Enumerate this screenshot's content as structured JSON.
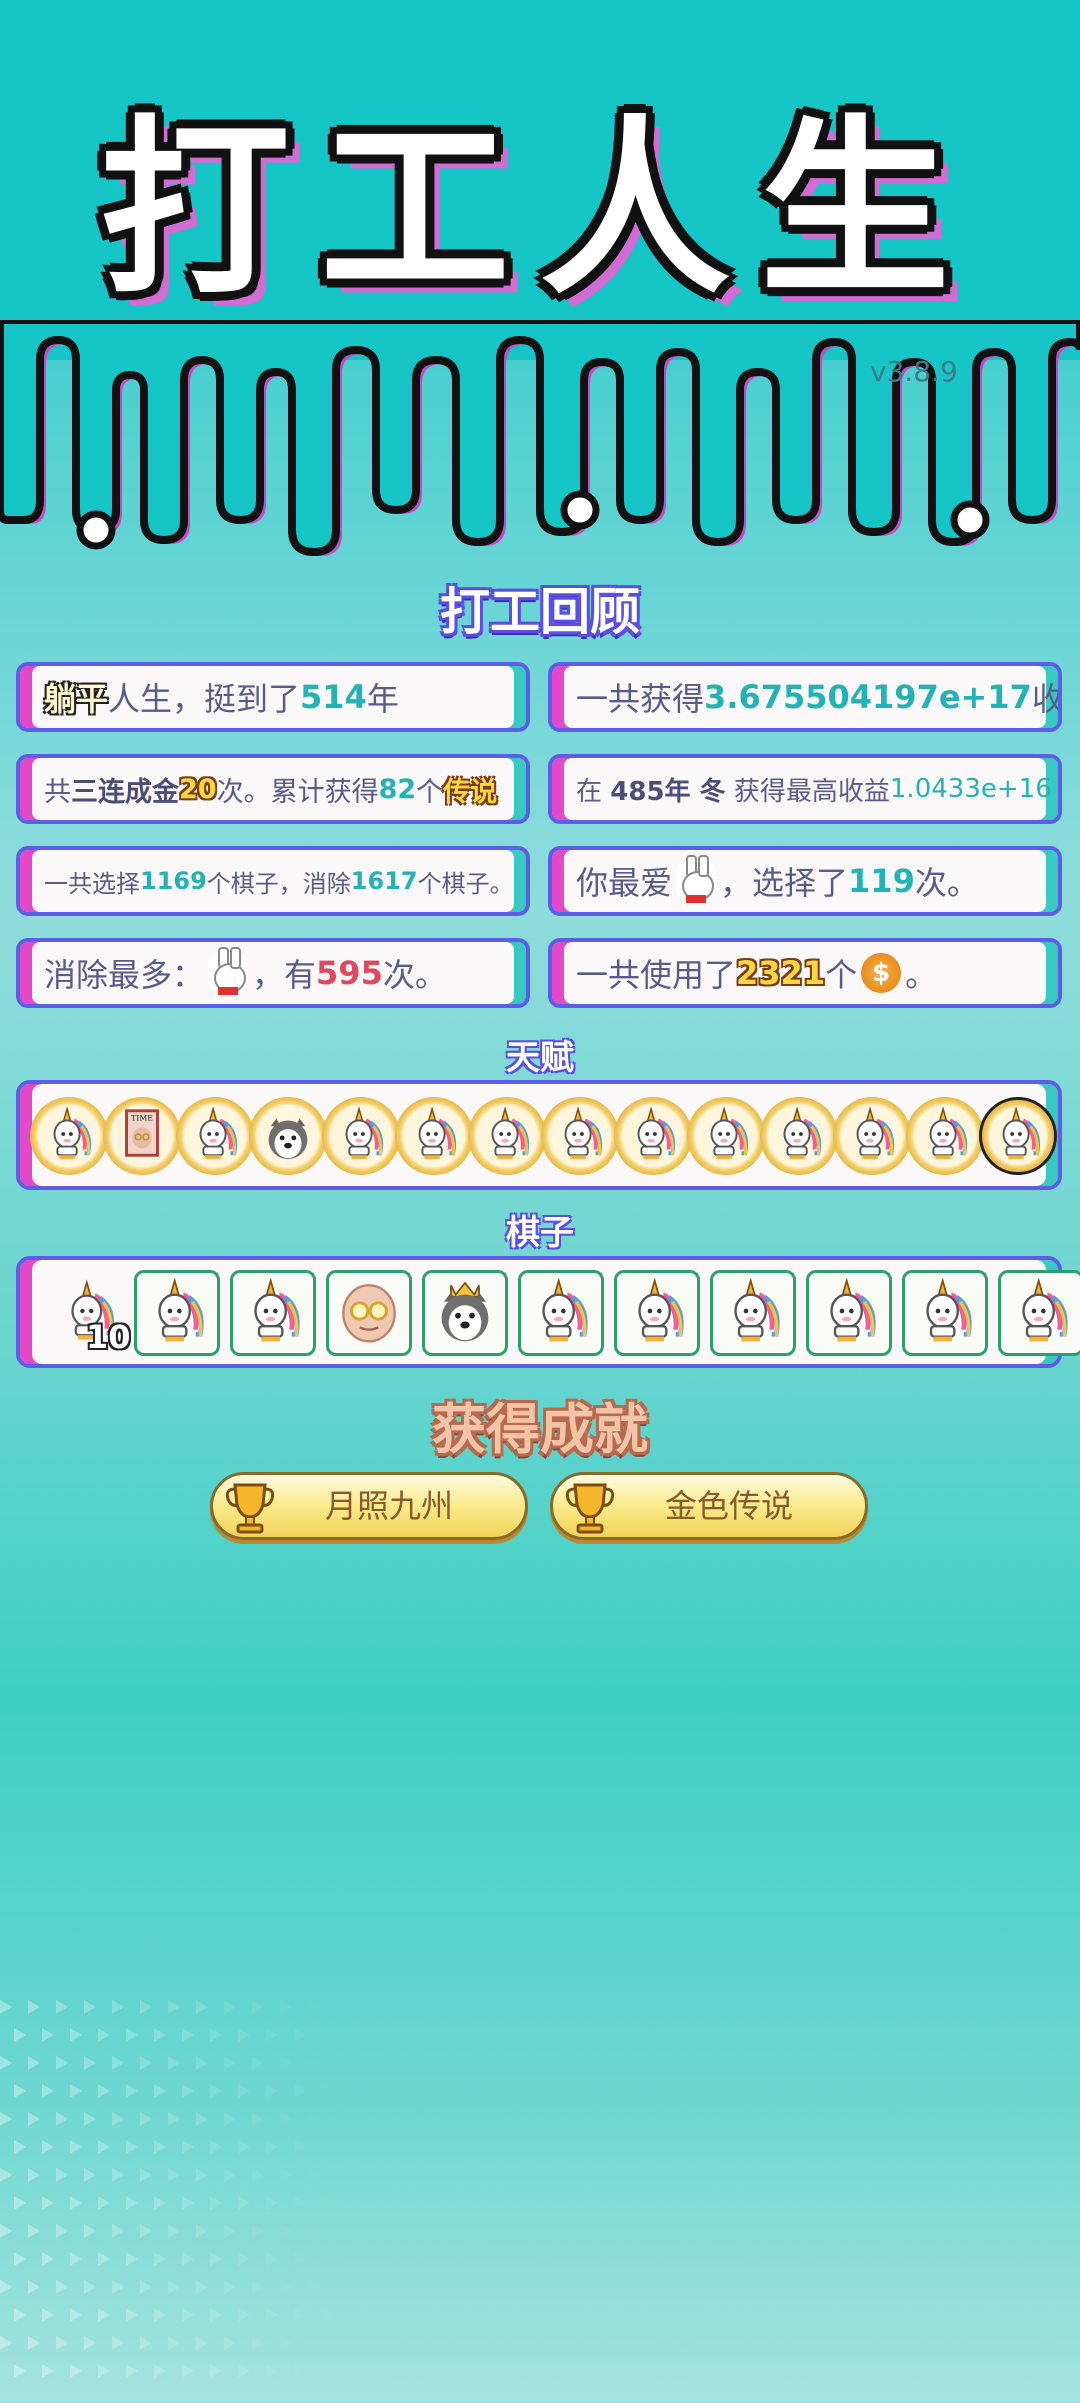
{
  "title": "打工人生",
  "version": "v3.8.9",
  "review": {
    "heading": "打工回顾",
    "card1": {
      "badge": "躺平",
      "pre": "人生，挺到了",
      "value": "514",
      "post": "年"
    },
    "card2": {
      "pre": "一共获得",
      "value": "3.675504197e+17",
      "post": "收益"
    },
    "card3": {
      "pre": "共",
      "combo": "三连成金",
      "count": "20",
      "mid": "次。累计获得",
      "legend_count": "82",
      "unit": "个",
      "legend": "传说"
    },
    "card4": {
      "pre": "在",
      "year": "485年 冬",
      "mid": "获得最高收益",
      "value": "1.0433e+16"
    },
    "card5": {
      "pre": "一共选择",
      "choose": "1169",
      "mid": "个棋子，消除",
      "remove": "1617",
      "post": "个棋子。"
    },
    "card6": {
      "pre": "你最爱",
      "mid": "，选择了",
      "value": "119",
      "post": "次。"
    },
    "card7": {
      "pre": "消除最多：",
      "mid": "，有",
      "value": "595",
      "post": "次。"
    },
    "card8": {
      "pre": "一共使用了",
      "value": "2321",
      "mid": "个",
      "post": "。"
    }
  },
  "talents": {
    "heading": "天赋",
    "items": [
      "unicorn",
      "time-magazine",
      "unicorn",
      "husky",
      "unicorn",
      "unicorn",
      "unicorn",
      "unicorn",
      "unicorn",
      "unicorn",
      "unicorn",
      "unicorn",
      "unicorn",
      "unicorn"
    ],
    "selected_index": 13
  },
  "pieces": {
    "heading": "棋子",
    "first_count": "10",
    "items": [
      "unicorn",
      "unicorn",
      "old-man",
      "husky-king",
      "unicorn",
      "unicorn",
      "unicorn",
      "unicorn",
      "unicorn",
      "unicorn"
    ]
  },
  "achievements": {
    "heading": "获得成就",
    "items": [
      "月照九州",
      "金色传说"
    ]
  },
  "colors": {
    "accent_teal": "#23b3b7",
    "accent_red": "#e0485e",
    "border": "#5d5ee6",
    "stripe_pink": "#e349c9"
  }
}
